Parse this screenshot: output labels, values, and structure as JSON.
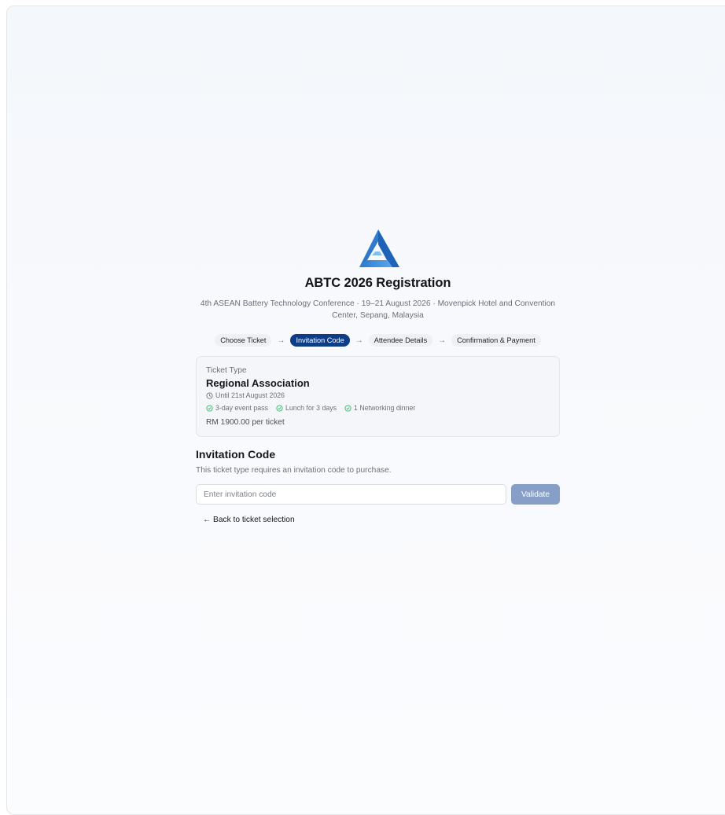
{
  "header": {
    "title": "ABTC 2026 Registration",
    "subtitle": "4th ASEAN Battery Technology Conference · 19–21 August 2026 · Movenpick Hotel and Convention Center, Sepang, Malaysia",
    "logo": "abtc-triangle-logo"
  },
  "steps": [
    {
      "label": "Choose Ticket",
      "active": false
    },
    {
      "label": "Invitation Code",
      "active": true
    },
    {
      "label": "Attendee Details",
      "active": false
    },
    {
      "label": "Confirmation & Payment",
      "active": false
    }
  ],
  "ticket": {
    "label": "Ticket Type",
    "name": "Regional Association",
    "until": "Until 21st August 2026",
    "perks": [
      "3-day event pass",
      "Lunch for 3 days",
      "1 Networking dinner"
    ],
    "price": "RM 1900.00 per ticket"
  },
  "invitation": {
    "title": "Invitation Code",
    "description": "This ticket type requires an invitation code to purchase.",
    "input_placeholder": "Enter invitation code",
    "input_value": "",
    "validate_label": "Validate"
  },
  "back_link": "← Back to ticket selection",
  "colors": {
    "accent": "#0f3d85",
    "validate_disabled": "#879fc6",
    "check": "#2fb36a"
  }
}
